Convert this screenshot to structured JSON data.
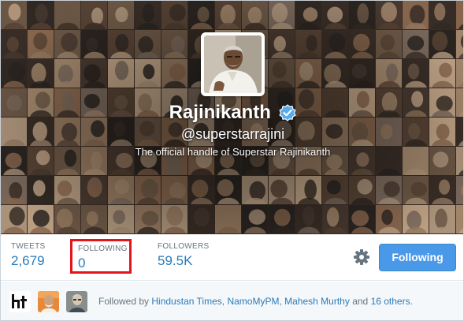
{
  "profile": {
    "display_name": "Rajinikanth",
    "handle": "@superstarrajini",
    "bio": "The official handle of Superstar Rajinikanth",
    "verified_icon": "verified-badge-icon",
    "avatar_icon": "profile-avatar-image",
    "header_icon": "header-collage-image"
  },
  "stats": {
    "tweets_label": "TWEETS",
    "tweets_value": "2,679",
    "following_label": "FOLLOWING",
    "following_value": "0",
    "followers_label": "FOLLOWERS",
    "followers_value": "59.5K"
  },
  "actions": {
    "gear_icon": "gear-icon",
    "following_label": "Following"
  },
  "followed_by": {
    "prefix": "Followed by",
    "user_1": "Hindustan Times",
    "sep_1": ",",
    "user_2": "NamoMyPM",
    "sep_2": ",",
    "user_3": "Mahesh Murthy",
    "and": "and",
    "others": "16 others",
    "end": "."
  },
  "colors": {
    "accent": "#2b7bb9",
    "button": "#4a99e9",
    "highlight_box": "#e3141b",
    "verified": "#55acee"
  }
}
